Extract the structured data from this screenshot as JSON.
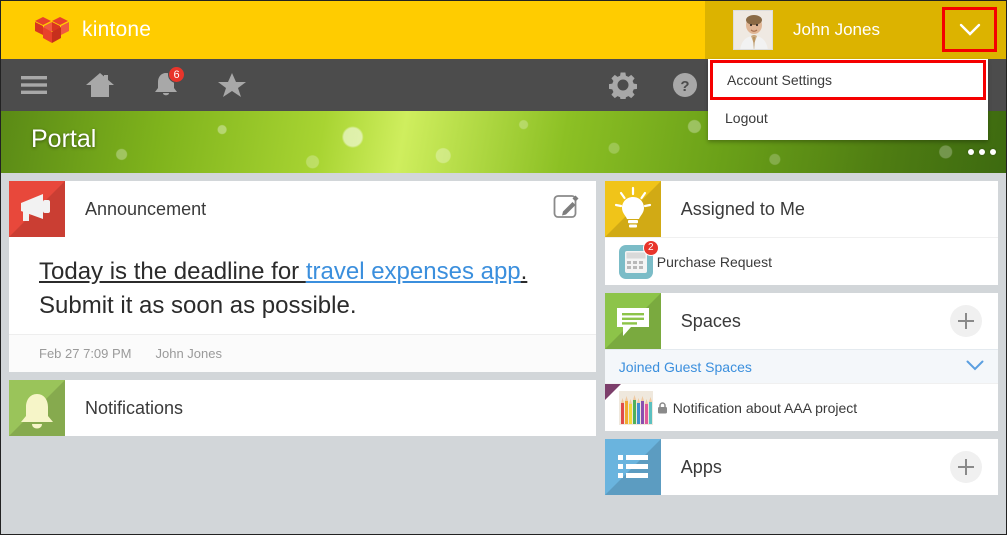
{
  "header": {
    "brand_name": "kintone",
    "brand_logo_icon": "kintone-cube-logo",
    "user": {
      "name": "John Jones",
      "avatar_icon": "user-avatar-photo",
      "chevron_icon": "chevron-down-icon"
    }
  },
  "user_menu": {
    "items": [
      {
        "label": "Account Settings",
        "highlighted": true
      },
      {
        "label": "Logout",
        "highlighted": false
      }
    ]
  },
  "navbar": {
    "left_items": [
      {
        "name": "menu-icon",
        "label": "Menu"
      },
      {
        "name": "home-icon",
        "label": "Home"
      },
      {
        "name": "bell-icon",
        "label": "Notifications",
        "badge": "6"
      },
      {
        "name": "star-icon",
        "label": "Favorites"
      }
    ],
    "right_items": [
      {
        "name": "gear-icon",
        "label": "Settings"
      },
      {
        "name": "help-icon",
        "label": "Help"
      }
    ]
  },
  "banner": {
    "title": "Portal",
    "more_icon": "more-dots-icon"
  },
  "announcement": {
    "icon": "megaphone-icon",
    "title": "Announcement",
    "edit_icon": "edit-pencil-icon",
    "body_prefix": "Today is the deadline for ",
    "body_link": "travel expenses app",
    "body_period": ".",
    "body_second_line": "Submit it as soon as possible.",
    "footer_date": "Feb 27 7:09 PM",
    "footer_author": "John Jones"
  },
  "notifications_panel": {
    "icon": "bell-green-icon",
    "title": "Notifications"
  },
  "assigned_to_me": {
    "icon": "lightbulb-icon",
    "title": "Assigned to Me",
    "items": [
      {
        "label": "Purchase Request",
        "badge": "2",
        "thumb_icon": "calculator-app-icon"
      }
    ]
  },
  "spaces": {
    "icon": "speech-bubble-icon",
    "title": "Spaces",
    "add_icon": "plus-icon",
    "group_label": "Joined Guest Spaces",
    "group_chevron_icon": "chevron-down-icon",
    "items": [
      {
        "label": "Notification about AAA project",
        "lock_icon": "lock-icon",
        "thumb_icon": "pencils-photo-icon"
      }
    ]
  },
  "apps": {
    "icon": "app-list-icon",
    "title": "Apps",
    "add_icon": "plus-icon"
  },
  "colors": {
    "brand_yellow": "#ffcc00",
    "brand_yellow_dark": "#dcb300",
    "navbar_gray": "#4c4c4c",
    "highlight_red": "#f50000",
    "link_blue": "#3b8fdd",
    "badge_red": "#e8352b"
  }
}
